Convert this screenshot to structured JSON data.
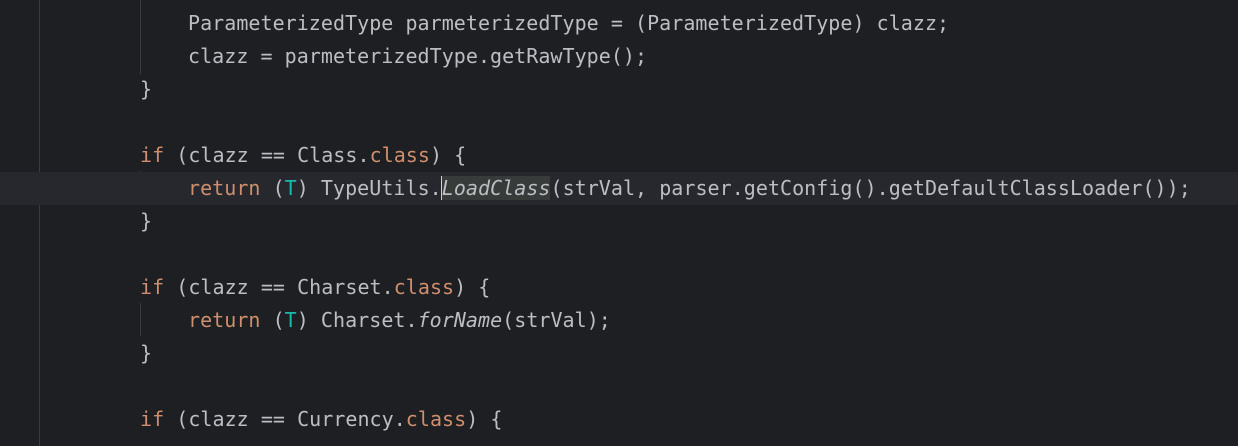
{
  "editor": {
    "lines": [
      {
        "id": "l1",
        "parts": [
          "ParameterizedType parmeterizedType = (ParameterizedType) clazz;"
        ]
      },
      {
        "id": "l2",
        "parts": [
          "clazz = parmeterizedType.getRawType();"
        ]
      },
      {
        "id": "l3",
        "parts": [
          "}"
        ]
      },
      {
        "id": "l5",
        "parts": [
          "if",
          " (clazz == Class.",
          "class",
          ") {"
        ]
      },
      {
        "id": "l6",
        "parts": [
          "return",
          " (",
          "T",
          ") TypeUtils.",
          "LoadClass",
          "(strVal, parser.getConfig().getDefaultClassLoader());"
        ]
      },
      {
        "id": "l7",
        "parts": [
          "}"
        ]
      },
      {
        "id": "l9",
        "parts": [
          "if",
          " (clazz == Charset.",
          "class",
          ") {"
        ]
      },
      {
        "id": "l10",
        "parts": [
          "return",
          " (",
          "T",
          ") Charset.",
          "forName",
          "(strVal);"
        ]
      },
      {
        "id": "l11",
        "parts": [
          "}"
        ]
      },
      {
        "id": "l13",
        "parts": [
          "if",
          " (clazz == Currency.",
          "class",
          ") {"
        ]
      }
    ],
    "colors": {
      "background": "#1e1f22",
      "current_line": "#26282e",
      "text": "#bcbec4",
      "keyword": "#cf8e6d",
      "type_param": "#16baac",
      "indent_guide": "#393b40"
    }
  }
}
